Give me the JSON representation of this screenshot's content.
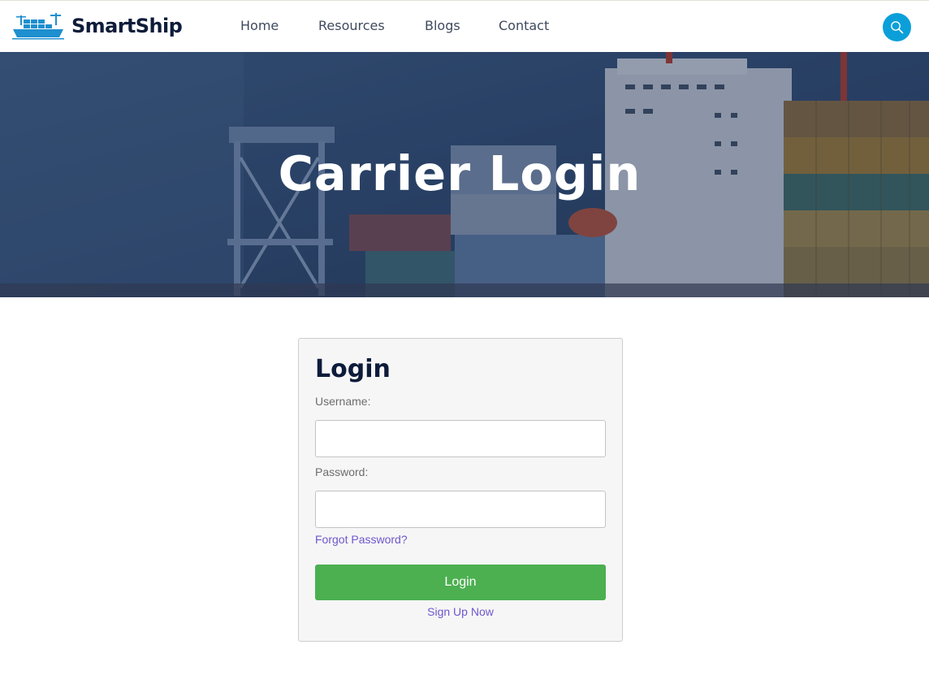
{
  "header": {
    "brand": "SmartShip",
    "logo_icon": "container-ship-icon",
    "nav": [
      "Home",
      "Resources",
      "Blogs",
      "Contact"
    ],
    "search_icon": "search-icon"
  },
  "hero": {
    "title": "Carrier Login"
  },
  "login_form": {
    "title": "Login",
    "username_label": "Username:",
    "username_value": "",
    "password_label": "Password:",
    "password_value": "",
    "forgot_password": "Forgot Password?",
    "submit_label": "Login",
    "signup_link": "Sign Up Now"
  },
  "colors": {
    "brand_text": "#0d1c3a",
    "accent_blue": "#0b9fd9",
    "login_button": "#4caf50",
    "link": "#6e58cc"
  }
}
